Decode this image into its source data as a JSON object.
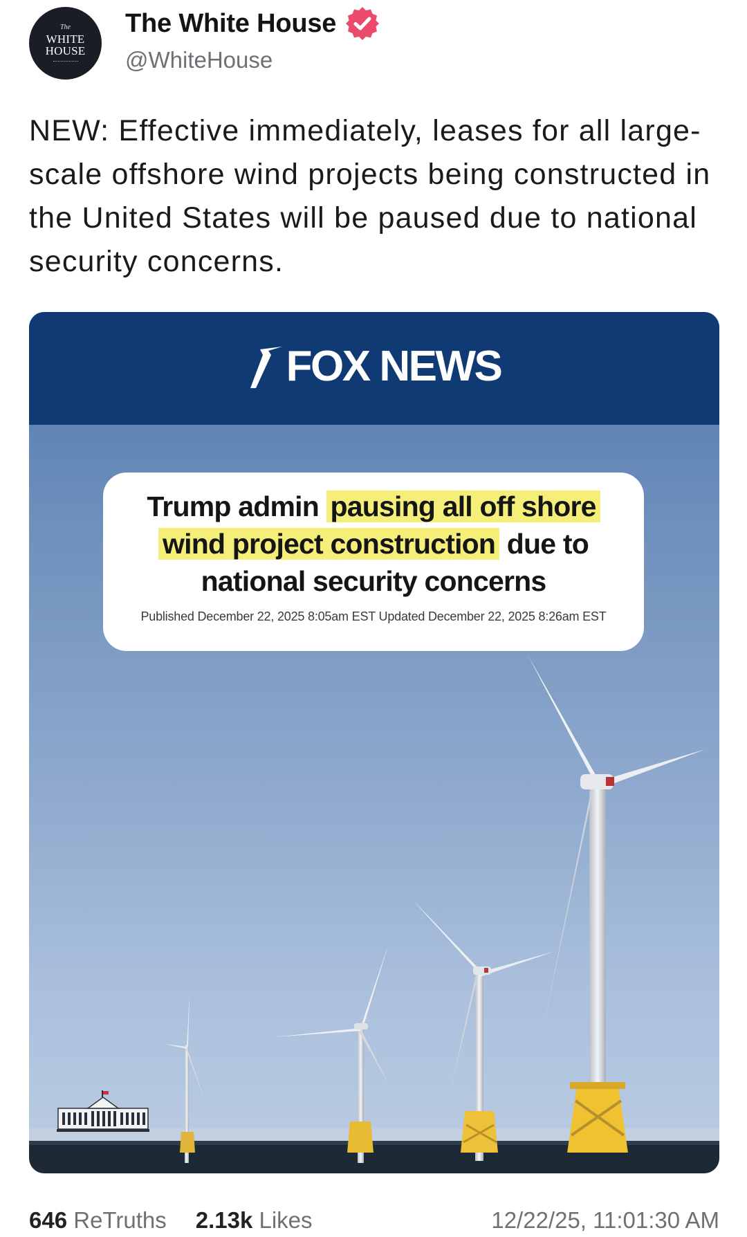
{
  "author": {
    "avatar_lines": [
      "The",
      "WHITE",
      "HOUSE"
    ],
    "display_name": "The White House",
    "handle": "@WhiteHouse",
    "verified_icon": "verified-badge-icon",
    "verified_color": "#ea4b6c"
  },
  "post": {
    "text": "NEW: Effective immediately, leases for all large-scale offshore wind projects being constructed in the United States will be paused due to national security concerns."
  },
  "media": {
    "brand": "FOX NEWS",
    "headline_plain_1": "Trump admin ",
    "headline_highlight_1": "pausing all off shore",
    "headline_highlight_2": "wind project construction",
    "headline_plain_2": " due to",
    "headline_plain_3": "national security concerns",
    "published": "Published December 22, 2025 8:05am EST Updated December 22, 2025 8:26am EST",
    "highlight_color": "#f5ef7a",
    "banner_color": "#0f3a73",
    "watermark_icon": "white-house-icon"
  },
  "stats": {
    "retruths_count": "646",
    "retruths_label": "ReTruths",
    "likes_count": "2.13k",
    "likes_label": "Likes",
    "timestamp": "12/22/25, 11:01:30 AM"
  }
}
